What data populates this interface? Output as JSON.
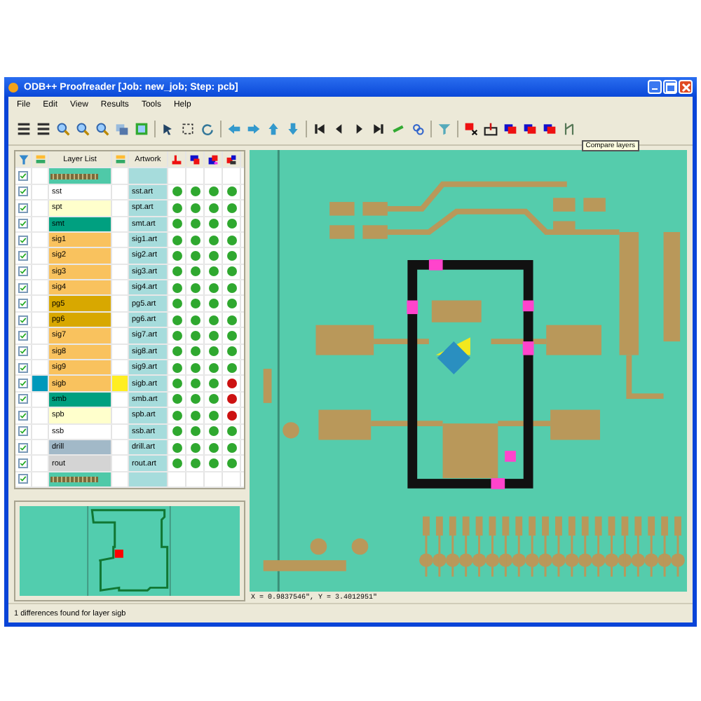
{
  "window": {
    "title": "ODB++ Proofreader [Job: new_job; Step: pcb]"
  },
  "menu": [
    "File",
    "Edit",
    "View",
    "Results",
    "Tools",
    "Help"
  ],
  "tooltip": "Compare layers",
  "layer_table": {
    "columns": {
      "layer": "Layer List",
      "artwork": "Artwork"
    },
    "rows": [
      {
        "kind": "connector",
        "checked": true,
        "color": "#4fc9a8"
      },
      {
        "kind": "layer",
        "checked": true,
        "name": "sst",
        "artwork": "sst.art",
        "color": "#ffffff",
        "matches": [
          true,
          true,
          true,
          true
        ]
      },
      {
        "kind": "layer",
        "checked": true,
        "name": "spt",
        "artwork": "spt.art",
        "color": "#ffffcc",
        "matches": [
          true,
          true,
          true,
          true
        ]
      },
      {
        "kind": "layer",
        "checked": true,
        "name": "smt",
        "artwork": "smt.art",
        "color": "#00a080",
        "matches": [
          true,
          true,
          true,
          true
        ]
      },
      {
        "kind": "layer",
        "checked": true,
        "name": "sig1",
        "artwork": "sig1.art",
        "color": "#f9c25e",
        "matches": [
          true,
          true,
          true,
          true
        ]
      },
      {
        "kind": "layer",
        "checked": true,
        "name": "sig2",
        "artwork": "sig2.art",
        "color": "#f9c25e",
        "matches": [
          true,
          true,
          true,
          true
        ]
      },
      {
        "kind": "layer",
        "checked": true,
        "name": "sig3",
        "artwork": "sig3.art",
        "color": "#f9c25e",
        "matches": [
          true,
          true,
          true,
          true
        ]
      },
      {
        "kind": "layer",
        "checked": true,
        "name": "sig4",
        "artwork": "sig4.art",
        "color": "#f9c25e",
        "matches": [
          true,
          true,
          true,
          true
        ]
      },
      {
        "kind": "layer",
        "checked": true,
        "name": "pg5",
        "artwork": "pg5.art",
        "color": "#d8a800",
        "matches": [
          true,
          true,
          true,
          true
        ]
      },
      {
        "kind": "layer",
        "checked": true,
        "name": "pg6",
        "artwork": "pg6.art",
        "color": "#d8a800",
        "matches": [
          true,
          true,
          true,
          true
        ]
      },
      {
        "kind": "layer",
        "checked": true,
        "name": "sig7",
        "artwork": "sig7.art",
        "color": "#f9c25e",
        "matches": [
          true,
          true,
          true,
          true
        ]
      },
      {
        "kind": "layer",
        "checked": true,
        "name": "sig8",
        "artwork": "sig8.art",
        "color": "#f9c25e",
        "matches": [
          true,
          true,
          true,
          true
        ]
      },
      {
        "kind": "layer",
        "checked": true,
        "name": "sig9",
        "artwork": "sig9.art",
        "color": "#f9c25e",
        "matches": [
          true,
          true,
          true,
          true
        ]
      },
      {
        "kind": "layer",
        "checked": true,
        "name": "sigb",
        "artwork": "sigb.art",
        "color": "#f9c25e",
        "left_marker": {
          "color": "#0099bb"
        },
        "right_marker": {
          "color": "#ffee22"
        },
        "matches": [
          true,
          true,
          true,
          false
        ]
      },
      {
        "kind": "layer",
        "checked": true,
        "name": "smb",
        "artwork": "smb.art",
        "color": "#00a080",
        "matches": [
          true,
          true,
          true,
          false
        ]
      },
      {
        "kind": "layer",
        "checked": true,
        "name": "spb",
        "artwork": "spb.art",
        "color": "#ffffcc",
        "matches": [
          true,
          true,
          true,
          false
        ]
      },
      {
        "kind": "layer",
        "checked": true,
        "name": "ssb",
        "artwork": "ssb.art",
        "color": "#ffffff",
        "matches": [
          true,
          true,
          true,
          true
        ]
      },
      {
        "kind": "layer",
        "checked": true,
        "name": "drill",
        "artwork": "drill.art",
        "color": "#a2b9c8",
        "matches": [
          true,
          true,
          true,
          true
        ]
      },
      {
        "kind": "layer",
        "checked": true,
        "name": "rout",
        "artwork": "rout.art",
        "color": "#d4d4d4",
        "matches": [
          true,
          true,
          true,
          true
        ]
      },
      {
        "kind": "connector",
        "checked": true,
        "color": "#4fc9a8"
      }
    ]
  },
  "coordinates": "X = 0.9837546\", Y = 3.4012951\"",
  "status_bar": "1 differences found for layer sigb"
}
